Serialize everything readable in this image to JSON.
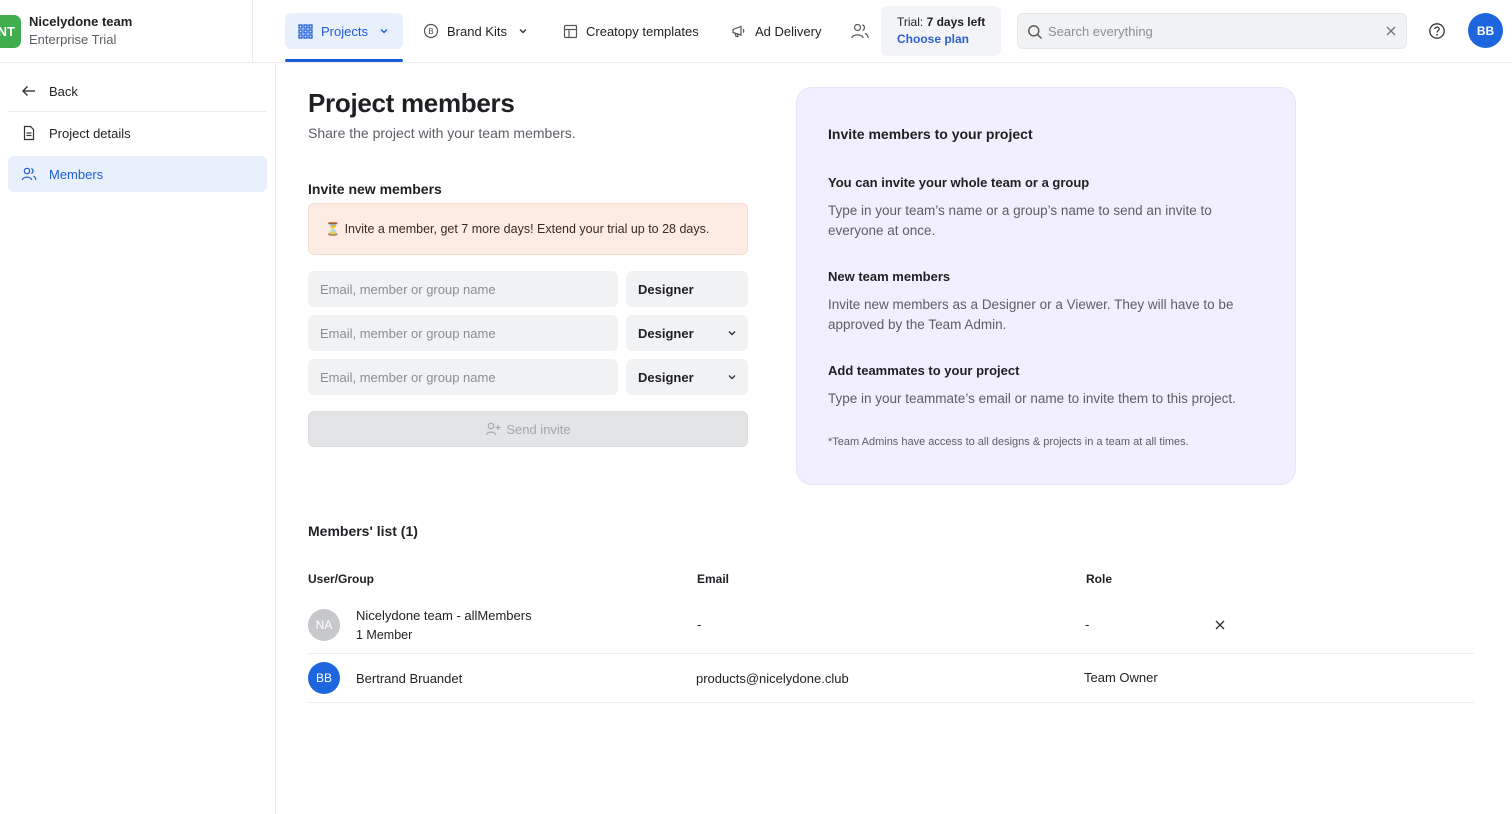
{
  "team": {
    "initials": "NT",
    "name": "Nicelydone team",
    "plan": "Enterprise Trial"
  },
  "nav": {
    "projects": "Projects",
    "brand_kits": "Brand Kits",
    "templates": "Creatopy templates",
    "ad_delivery": "Ad Delivery"
  },
  "trial": {
    "prefix": "Trial: ",
    "days": "7 days left",
    "link": "Choose plan"
  },
  "search": {
    "placeholder": "Search everything",
    "value": ""
  },
  "user": {
    "initials": "BB"
  },
  "sidebar": {
    "back": "Back",
    "items": [
      {
        "label": "Project details"
      },
      {
        "label": "Members"
      }
    ]
  },
  "main": {
    "title": "Project members",
    "subtitle": "Share the project with your team members.",
    "invite_heading": "Invite new members",
    "banner_icon": "⏳",
    "banner_text": "Invite a member, get 7 more days! Extend your trial up to 28 days.",
    "rows": [
      {
        "placeholder": "Email, member or group name",
        "role": "Designer"
      },
      {
        "placeholder": "Email, member or group name",
        "role": "Designer"
      },
      {
        "placeholder": "Email, member or group name",
        "role": "Designer"
      }
    ],
    "send_label": "Send invite"
  },
  "info": {
    "title": "Invite members to your project",
    "sections": [
      {
        "heading": "You can invite your whole team or a group",
        "text": "Type in your team’s name or a group’s name to send an invite to everyone at once."
      },
      {
        "heading": "New team members",
        "text": "Invite new members as a Designer or a Viewer. They will have to be approved by the Team Admin."
      },
      {
        "heading": "Add teammates to your project",
        "text": "Type in your teammate’s email or name to invite them to this project."
      }
    ],
    "note": "*Team Admins have access to all designs & projects in a team at all times."
  },
  "members": {
    "heading": "Members' list (1)",
    "columns": [
      "User/Group",
      "Email",
      "Role"
    ],
    "rows": [
      {
        "initials": "NA",
        "name": "Nicelydone team - allMembers",
        "count": "1 Member",
        "email": "-",
        "role": "-"
      },
      {
        "initials": "BB",
        "name": "Bertrand Bruandet",
        "email": "products@nicelydone.club",
        "role": "Team Owner"
      }
    ]
  },
  "colors": {
    "accent": "#1d5dd6",
    "team_logo": "#3fae4f",
    "info_panel": "#f1effd",
    "banner": "#fdece4"
  }
}
